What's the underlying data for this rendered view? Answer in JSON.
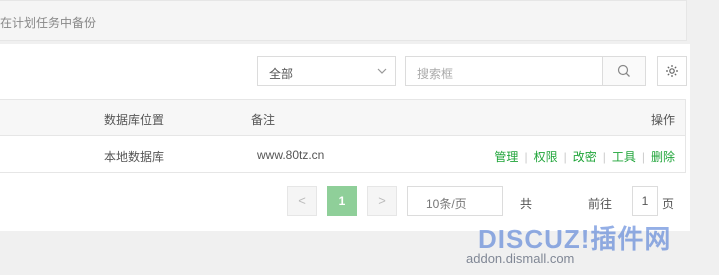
{
  "tip": {
    "text": "在计划任务中备份"
  },
  "toolbar": {
    "select_value": "全部",
    "search_placeholder": "搜索框"
  },
  "table": {
    "headers": {
      "location": "数据库位置",
      "note": "备注",
      "actions": "操作"
    },
    "rows": [
      {
        "location": "本地数据库",
        "note": "www.80tz.cn",
        "actions": [
          "管理",
          "权限",
          "改密",
          "工具",
          "删除"
        ]
      }
    ]
  },
  "pagination": {
    "prev": "<",
    "current": "1",
    "next": ">",
    "per_page": "10条/页",
    "total_label": "共",
    "goto_label": "前往",
    "goto_value": "1",
    "page_suffix": "页"
  },
  "watermark": {
    "text": "DISCUZ!插件网",
    "url": "addon.dismall.com"
  },
  "colors": {
    "accent": "#20a53a",
    "current_page": "#8fcf99",
    "header_bg": "#f7f7f7",
    "page_bg": "#f0f0f0"
  }
}
